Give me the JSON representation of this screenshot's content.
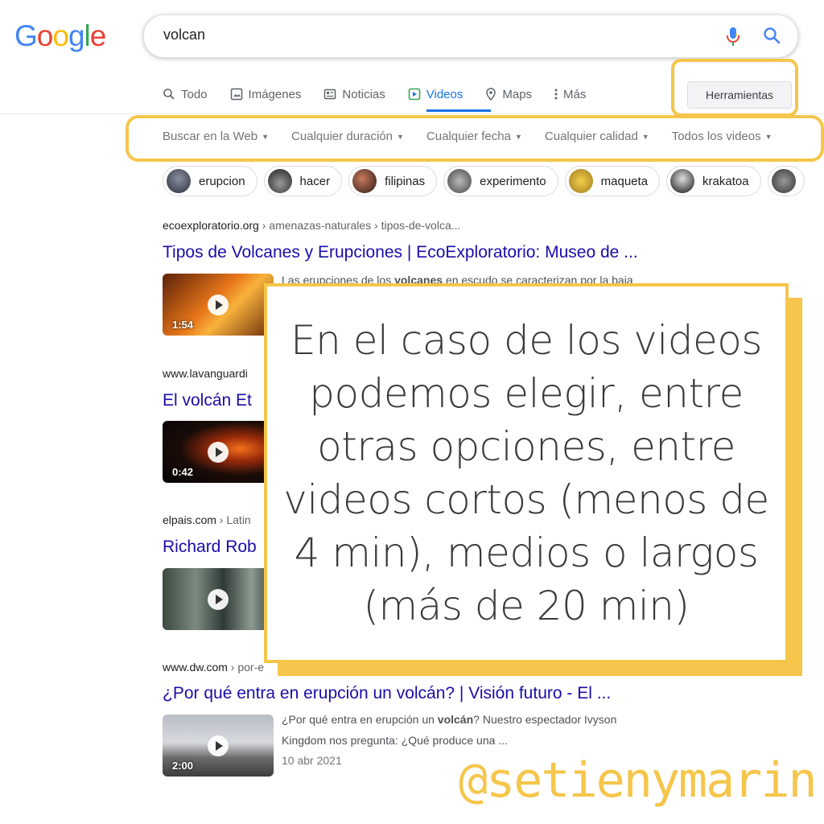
{
  "logo": {
    "letters": [
      "G",
      "o",
      "o",
      "g",
      "l",
      "e"
    ],
    "colors": [
      "#4285f4",
      "#ea4335",
      "#fbbc05",
      "#4285f4",
      "#34a853",
      "#ea4335"
    ]
  },
  "search": {
    "query": "volcan"
  },
  "tabs": [
    {
      "label": "Todo",
      "icon": "search-icon"
    },
    {
      "label": "Imágenes",
      "icon": "image-icon"
    },
    {
      "label": "Noticias",
      "icon": "news-icon"
    },
    {
      "label": "Videos",
      "icon": "video-icon"
    },
    {
      "label": "Maps",
      "icon": "map-pin-icon"
    },
    {
      "label": "Más",
      "icon": "more-vertical-icon"
    }
  ],
  "tools_label": "Herramientas",
  "filters": [
    "Buscar en la Web",
    "Cualquier duración",
    "Cualquier fecha",
    "Cualquier calidad",
    "Todos los videos"
  ],
  "chips": [
    "erupcion",
    "hacer",
    "filipinas",
    "experimento",
    "maqueta",
    "krakatoa"
  ],
  "results": [
    {
      "domain": "ecoexploratorio.org",
      "path": " › amenazas-naturales › tipos-de-volca...",
      "title": "Tipos de Volcanes y Erupciones | EcoExploratorio: Museo de ...",
      "snippet_pre": "Las erupciones de los ",
      "snippet_bold": "volcanes",
      "snippet_post": " en escudo se caracterizan por la baja",
      "duration": "1:54"
    },
    {
      "domain": "www.lavanguardi",
      "path": "",
      "title": "El volcán Et",
      "duration": "0:42"
    },
    {
      "domain": "elpais.com",
      "path": " › Latin",
      "title": "Richard Rob",
      "duration": ""
    },
    {
      "domain": "www.dw.com",
      "path": " › por-e",
      "title": "¿Por qué entra en erupción un volcán? | Visión futuro - El ...",
      "snippet_pre": "¿Por qué entra en erupción un ",
      "snippet_bold": "volcán",
      "snippet_post": "? Nuestro espectador Ivyson",
      "snippet_line2": "Kingdom nos pregunta: ¿Qué produce una ...",
      "date": "10 abr 2021",
      "duration": "2:00"
    }
  ],
  "overlay": {
    "text": "En el caso de los videos podemos elegir, entre otras opciones, entre videos cortos (menos de 4 min), medios o largos (más de 20 min)"
  },
  "handle": "@setienymarin",
  "colors": {
    "accent": "#f5c64b",
    "link": "#1a0dab",
    "tab_active": "#1a73e8"
  }
}
